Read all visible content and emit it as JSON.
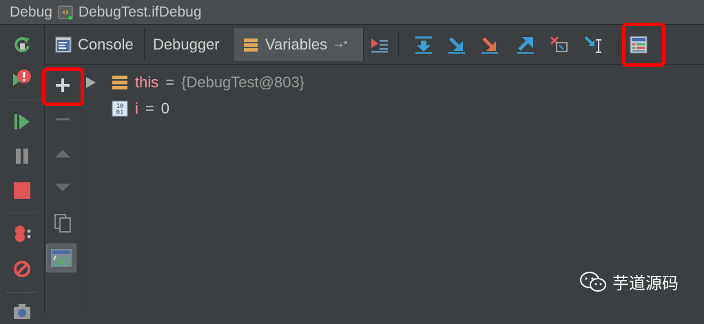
{
  "title": {
    "debug_label": "Debug",
    "config_name": "DebugTest.ifDebug"
  },
  "tabs": [
    {
      "label": "Console"
    },
    {
      "label": "Debugger"
    },
    {
      "label": "Variables"
    }
  ],
  "variables": [
    {
      "name": "this",
      "eq": "=",
      "value": "{DebugTest@803}",
      "icon": "object-field-icon",
      "expandable": true
    },
    {
      "name": "i",
      "eq": "=",
      "value": "0",
      "icon": "primitive-binary-icon",
      "expandable": false
    }
  ],
  "left_toolbar": [
    "rerun-icon",
    "restart-exception-icon",
    "resume-icon",
    "pause-icon",
    "stop-icon",
    "view-breakpoints-icon",
    "mute-breakpoints-icon",
    "camera-icon"
  ],
  "variables_toolbar": [
    "add-watch-icon",
    "remove-watch-icon",
    "move-up-icon",
    "move-down-icon",
    "copy-icon",
    "watches-glasses-icon"
  ],
  "debugger_toolbar": [
    "show-execution-point-icon",
    "step-over-icon",
    "step-into-icon",
    "force-step-into-icon",
    "step-out-icon",
    "drop-frame-icon",
    "run-to-cursor-icon",
    "evaluate-expression-icon"
  ],
  "watermark": {
    "text": "芋道源码"
  },
  "colors": {
    "highlight": "#ff0000",
    "var_name": "#ff8fa3",
    "background": "#3c3f41"
  }
}
